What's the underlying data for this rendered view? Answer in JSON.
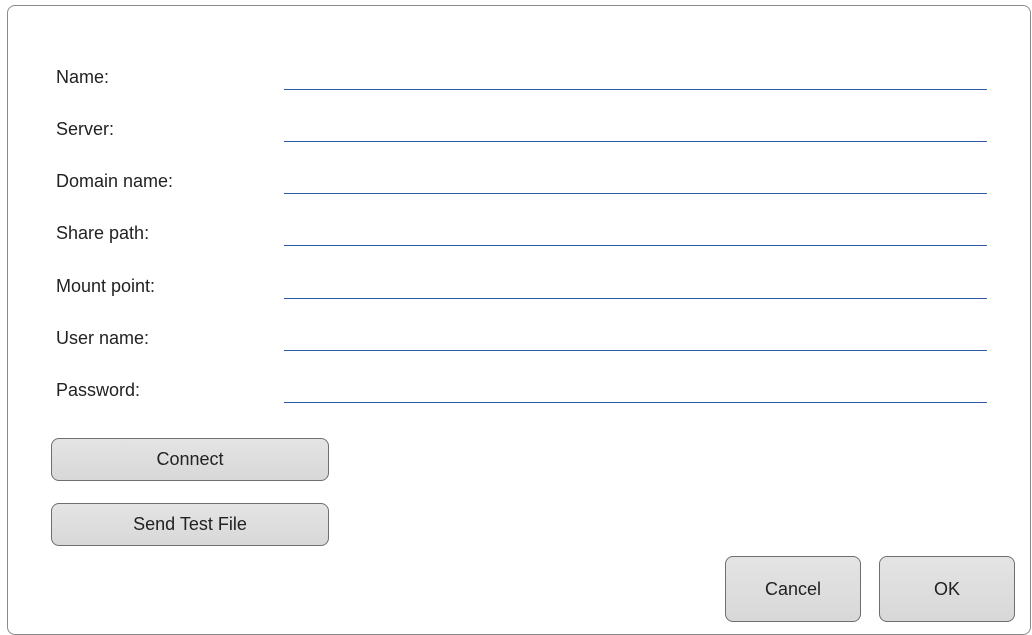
{
  "form": {
    "fields": [
      {
        "label": "Name:",
        "value": ""
      },
      {
        "label": "Server:",
        "value": ""
      },
      {
        "label": "Domain name:",
        "value": ""
      },
      {
        "label": "Share path:",
        "value": ""
      },
      {
        "label": "Mount point:",
        "value": ""
      },
      {
        "label": "User name:",
        "value": ""
      },
      {
        "label": "Password:",
        "value": ""
      }
    ]
  },
  "actions": {
    "connect_label": "Connect",
    "send_test_file_label": "Send Test File",
    "cancel_label": "Cancel",
    "ok_label": "OK"
  },
  "colors": {
    "field_underline": "#2c5aa8",
    "button_fill": "#dddddd",
    "button_border": "#6f6f6f"
  }
}
